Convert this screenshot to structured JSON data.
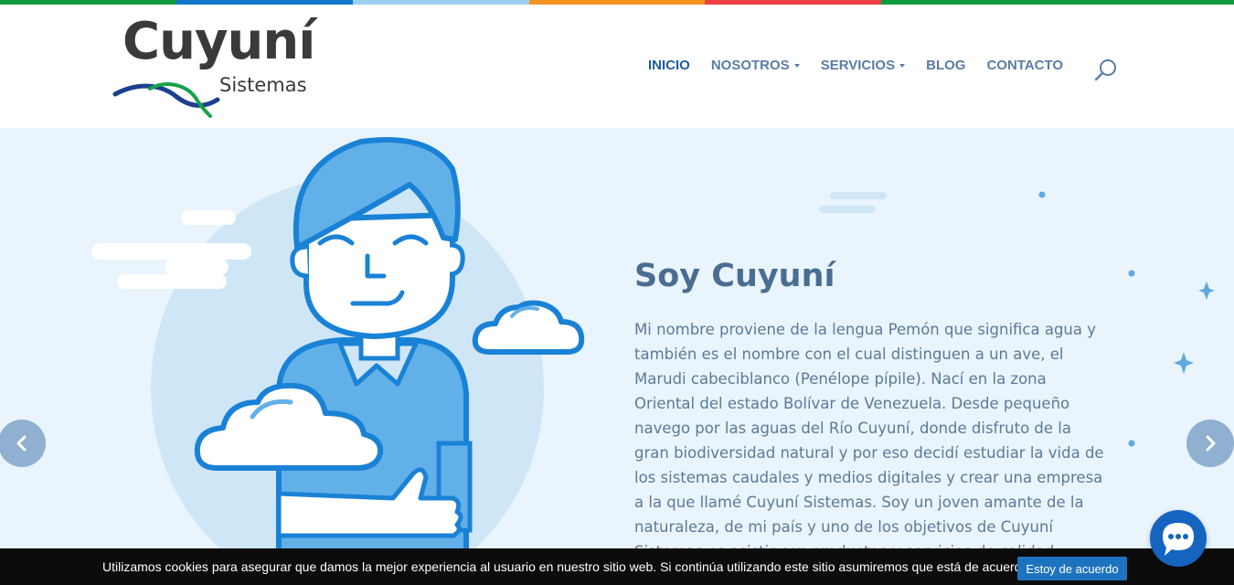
{
  "brand": {
    "name": "Cuyuní",
    "tagline": "Sistemas"
  },
  "colors": {
    "top_strip": [
      "#0e9a3f",
      "#1376c9",
      "#9cd0f2",
      "#f39322",
      "#ee3f43",
      "#0e9a3f",
      "#0e9a3f"
    ],
    "nav_active": "#1d5c9e",
    "nav_default": "#5b7da3",
    "hero_bg": "#e9f4fc",
    "title": "#4a6d92",
    "chat_button": "#1565c0",
    "cookie_button": "#1e73be"
  },
  "nav": {
    "items": [
      {
        "label": "INICIO",
        "active": true,
        "dropdown": false
      },
      {
        "label": "NOSOTROS",
        "active": false,
        "dropdown": true
      },
      {
        "label": "SERVICIOS",
        "active": false,
        "dropdown": true
      },
      {
        "label": "BLOG",
        "active": false,
        "dropdown": false
      },
      {
        "label": "CONTACTO",
        "active": false,
        "dropdown": false
      }
    ],
    "search_icon": "search-icon"
  },
  "hero": {
    "title": "Soy Cuyuní",
    "text": "Mi nombre proviene de la lengua Pemón que significa agua y también es el nombre con el cual distinguen a un ave, el Marudi cabeciblanco (Penélope pípile). Nací en la zona Oriental del estado Bolívar de Venezuela. Desde pequeño navego por las aguas del Río Cuyuní, donde disfruto de la gran biodiversidad natural y por eso decidí estudiar la vida de los sistemas caudales y medios digitales y crear una empresa a la que llamé Cuyuní Sistemas. Soy un joven amante de la naturaleza, de mi país y uno de los objetivos de Cuyuní Sistemas es asistir con productos y servicios de calidad"
  },
  "slider": {
    "prev_icon": "chevron-left-icon",
    "next_icon": "chevron-right-icon"
  },
  "chat": {
    "icon": "chat-bubble-icon"
  },
  "cookie": {
    "text": "Utilizamos cookies para asegurar que damos la mejor experiencia al usuario en nuestro sitio web. Si continúa utilizando este sitio asumiremos que está de acuerdo.",
    "accept_label": "Estoy de acuerdo"
  }
}
